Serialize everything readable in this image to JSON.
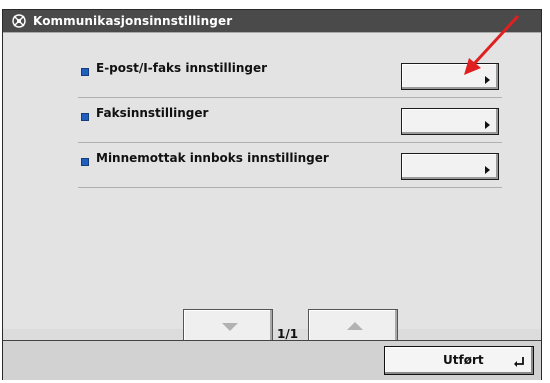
{
  "title": "Kommunikasjonsinnstillinger",
  "title_icon": "gear-wrench-icon",
  "items": [
    {
      "label": "E-post/I-faks innstillinger"
    },
    {
      "label": "Faksinnstillinger"
    },
    {
      "label": "Minnemottak innboks innstillinger"
    }
  ],
  "pager": {
    "page_text": "1/1",
    "down_icon": "triangle-down-icon",
    "up_icon": "triangle-up-icon"
  },
  "footer": {
    "ok_label": "Utført",
    "ok_icon": "enter-return-icon"
  },
  "colors": {
    "accent_bullet": "#1f5fbf",
    "annotation_arrow": "#e02020",
    "titlebar": "#4a4a4a"
  }
}
